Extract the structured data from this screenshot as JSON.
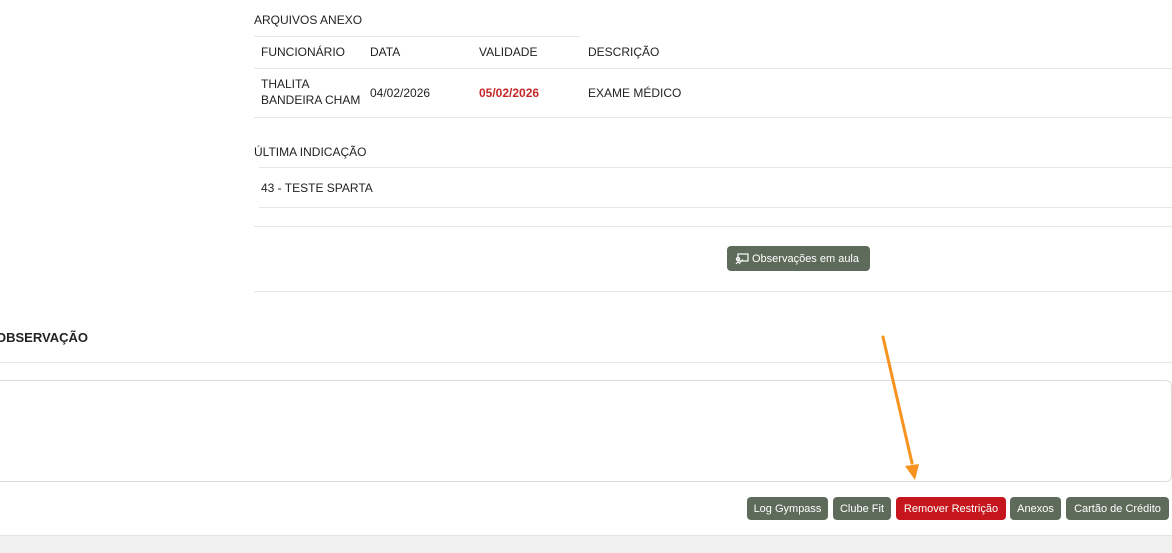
{
  "attachments": {
    "title": "ARQUIVOS ANEXO",
    "columns": [
      "FUNCIONÁRIO",
      "DATA",
      "VALIDADE",
      "DESCRIÇÃO"
    ],
    "rows": [
      {
        "employee": "THALITA BANDEIRA CHAM",
        "date": "04/02/2026",
        "validity": "05/02/2026",
        "description": "EXAME MÉDICO"
      }
    ]
  },
  "last_indication": {
    "title": "ÚLTIMA INDICAÇÃO",
    "value": "43 - TESTE SPARTA"
  },
  "class_notes_button": {
    "label": "Observações em aula",
    "icon": "chalkboard-icon"
  },
  "observation": {
    "title": "OBSERVAÇÃO",
    "value": ""
  },
  "actions": [
    {
      "label": "Log Gympass",
      "color": "#5e6b5b"
    },
    {
      "label": "Clube Fit",
      "color": "#5e6b5b"
    },
    {
      "label": "Remover Restrição",
      "color": "#c4161c"
    },
    {
      "label": "Anexos",
      "color": "#5e6b5b"
    },
    {
      "label": "Cartão de Crédito",
      "color": "#5e6b5b"
    }
  ],
  "annotation": {
    "type": "arrow",
    "color": "#f7931e"
  }
}
